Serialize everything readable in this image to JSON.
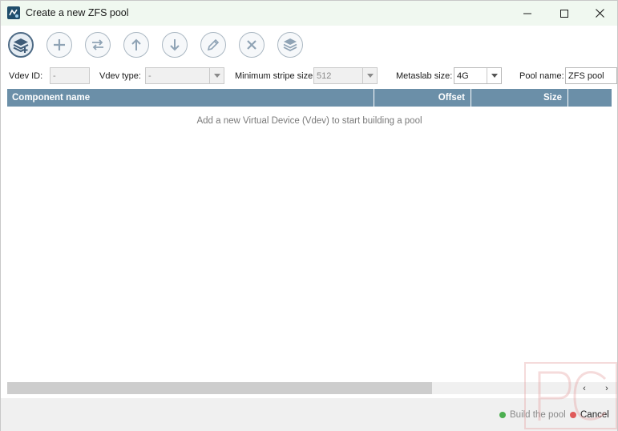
{
  "window": {
    "title": "Create a new ZFS pool"
  },
  "toolbar": {
    "buttons": [
      {
        "name": "add-vdev",
        "icon": "layers-plus-icon"
      },
      {
        "name": "add-component",
        "icon": "plus-icon"
      },
      {
        "name": "replace-component",
        "icon": "swap-icon"
      },
      {
        "name": "move-up",
        "icon": "arrow-up-icon"
      },
      {
        "name": "move-down",
        "icon": "arrow-down-icon"
      },
      {
        "name": "edit",
        "icon": "pencil-icon"
      },
      {
        "name": "remove",
        "icon": "x-icon"
      },
      {
        "name": "pool-layers",
        "icon": "layers-icon"
      }
    ]
  },
  "params": {
    "vdev_id_label": "Vdev ID:",
    "vdev_id_value": "-",
    "vdev_type_label": "Vdev type:",
    "vdev_type_value": "-",
    "min_stripe_label": "Minimum stripe size:",
    "min_stripe_value": "512",
    "metaslab_label": "Metaslab size:",
    "metaslab_value": "4G",
    "pool_name_label": "Pool name:",
    "pool_name_value": "ZFS pool"
  },
  "table": {
    "columns": [
      "Component name",
      "Offset",
      "Size"
    ],
    "rows": [],
    "empty_message": "Add a new Virtual Device (Vdev) to start building a pool"
  },
  "footer": {
    "build_label": "Build the pool",
    "cancel_label": "Cancel"
  },
  "colors": {
    "header_bg": "#6b8fa8",
    "build_dot": "#4caf50",
    "cancel_dot": "#e05a5a",
    "titlebar_bg": "#f0f8f0"
  }
}
